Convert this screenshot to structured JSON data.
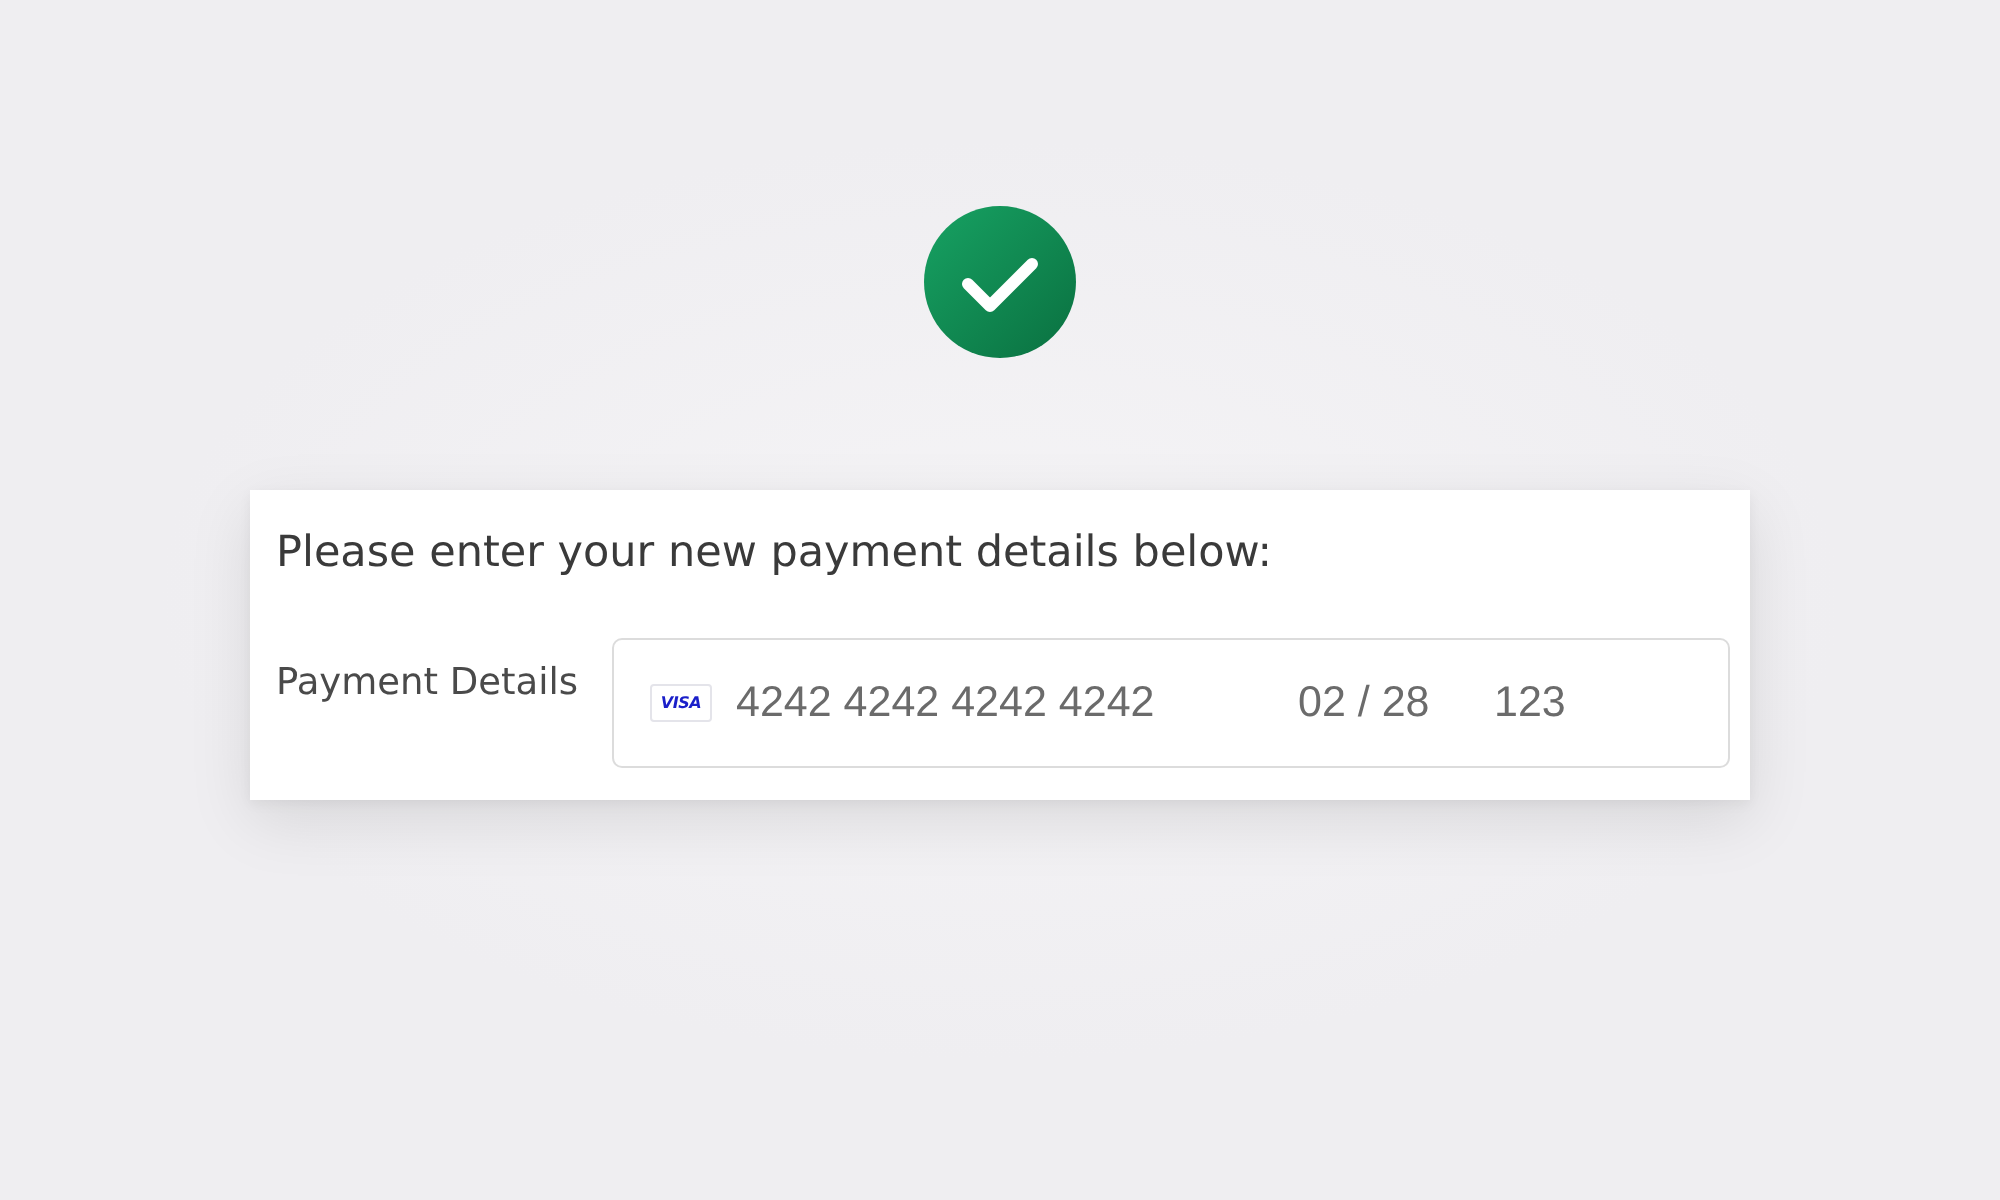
{
  "status": {
    "kind": "success"
  },
  "form": {
    "heading": "Please enter your new payment details below:",
    "label": "Payment Details",
    "card": {
      "brand": "VISA",
      "number": "4242 4242 4242 4242",
      "expiry": "02 / 28",
      "cvc": "123"
    }
  }
}
